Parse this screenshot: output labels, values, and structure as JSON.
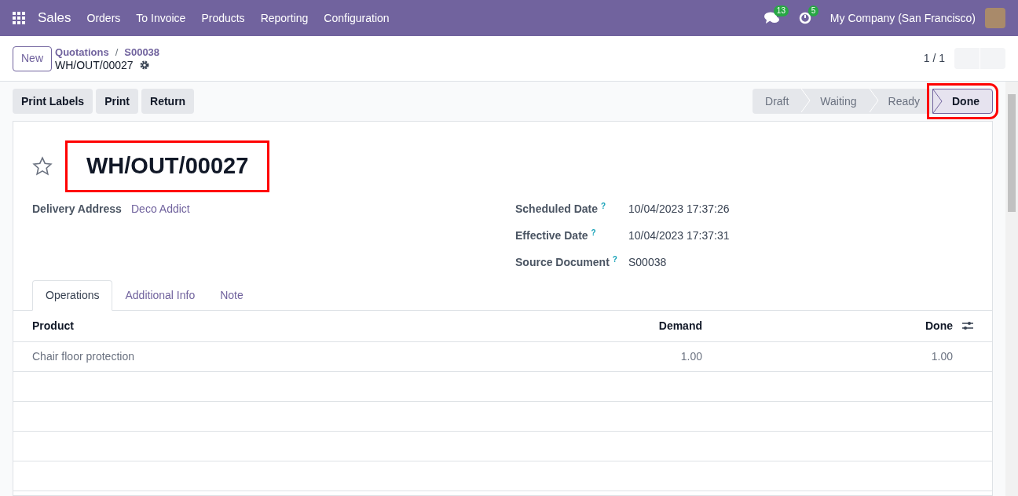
{
  "navbar": {
    "app": "Sales",
    "menu": [
      "Orders",
      "To Invoice",
      "Products",
      "Reporting",
      "Configuration"
    ],
    "messages_count": "13",
    "activities_count": "5",
    "company": "My Company (San Francisco)"
  },
  "control_panel": {
    "new_button": "New",
    "breadcrumbs": [
      "Quotations",
      "S00038"
    ],
    "breadcrumb_separator": "/",
    "record": "WH/OUT/00027",
    "pager": "1 / 1"
  },
  "actions": [
    "Print Labels",
    "Print",
    "Return"
  ],
  "stages": [
    {
      "label": "Draft",
      "selected": false,
      "highlighted": false
    },
    {
      "label": "Waiting",
      "selected": false,
      "highlighted": false
    },
    {
      "label": "Ready",
      "selected": false,
      "highlighted": false
    },
    {
      "label": "Done",
      "selected": true,
      "highlighted": true
    }
  ],
  "form": {
    "title": "WH/OUT/00027",
    "title_highlighted": true,
    "starred": false,
    "left_fields": [
      {
        "label": "Delivery Address",
        "value": "Deco Addict",
        "kind": "link"
      }
    ],
    "right_fields": [
      {
        "label": "Scheduled Date",
        "value": "10/04/2023 17:37:26",
        "kind": "text",
        "help": "?"
      },
      {
        "label": "Effective Date",
        "value": "10/04/2023 17:37:31",
        "kind": "text",
        "help": "?"
      },
      {
        "label": "Source Document",
        "value": "S00038",
        "kind": "text",
        "help": "?"
      }
    ]
  },
  "tabs": [
    {
      "label": "Operations",
      "selected": true
    },
    {
      "label": "Additional Info",
      "selected": false
    },
    {
      "label": "Note",
      "selected": false
    }
  ],
  "table": {
    "columns": [
      "Product",
      "Demand",
      "Done"
    ],
    "rows": [
      [
        "Chair floor protection",
        "1.00",
        "1.00"
      ]
    ]
  }
}
